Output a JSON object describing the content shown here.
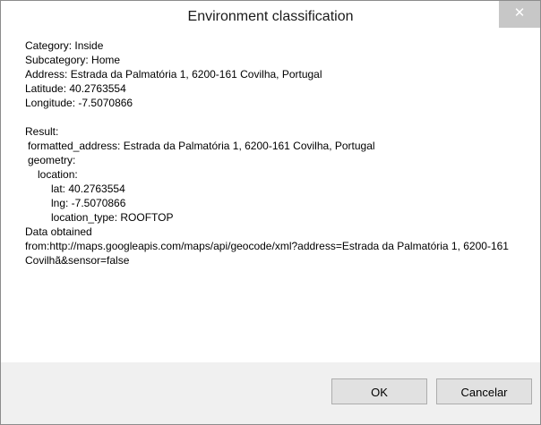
{
  "window": {
    "title": "Environment classification",
    "close_glyph": "✕"
  },
  "body": {
    "category": "Category: Inside",
    "subcategory": "Subcategory: Home",
    "address": "Address: Estrada da Palmatória 1, 6200-161 Covilha, Portugal",
    "latitude": "Latitude: 40.2763554",
    "longitude": "Longitude: -7.5070866",
    "result_label": "Result:",
    "formatted_address": "formatted_address: Estrada da Palmatória 1, 6200-161 Covilha, Portugal",
    "geometry_label": "geometry:",
    "location_label": "location:",
    "lat": "lat: 40.2763554",
    "lng": "lng: -7.5070866",
    "location_type": "location_type: ROOFTOP",
    "data_obtained": "Data obtained",
    "source_url": "from:http://maps.googleapis.com/maps/api/geocode/xml?address=Estrada da Palmatória 1, 6200-161 Covilhã&sensor=false"
  },
  "buttons": {
    "ok_label": "OK",
    "cancel_label": "Cancelar"
  }
}
